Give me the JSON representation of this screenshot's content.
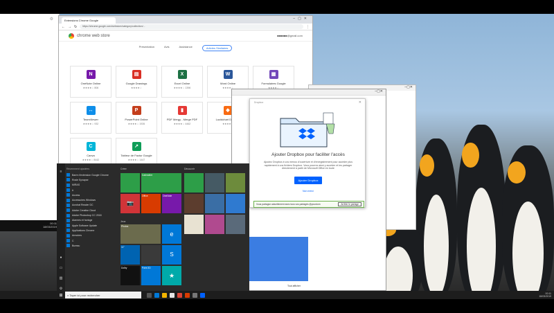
{
  "chrome": {
    "tab_title": "Extensions Chrome Google",
    "url": "https://chrome.google.com/webstore/category/collection/...",
    "store_title": "chrome web store",
    "user_email": "■■■■■■@gmail.com",
    "categories": [
      "Présentation",
      "Avis",
      "Assistance",
      "Articles Similaires"
    ],
    "apps": [
      {
        "name": "OneNote Online",
        "color": "#7719aa",
        "glyph": "N",
        "rating": "★★★★☆ 806"
      },
      {
        "name": "Google Drawings",
        "color": "#d93025",
        "glyph": "▤",
        "rating": "★★★★☆"
      },
      {
        "name": "Excel Online",
        "color": "#1e7145",
        "glyph": "X",
        "rating": "★★★★☆ 1396"
      },
      {
        "name": "Word Online",
        "color": "#2b579a",
        "glyph": "W",
        "rating": "★★★★☆"
      },
      {
        "name": "Formulaires Google",
        "color": "#7248b9",
        "glyph": "▦",
        "rating": "★★★★☆"
      },
      {
        "name": "TeamViewer",
        "color": "#0e8ee9",
        "glyph": "↔",
        "rating": "★★★★☆ 932"
      },
      {
        "name": "PowerPoint Online",
        "color": "#c43e1c",
        "glyph": "P",
        "rating": "★★★★☆ 1926"
      },
      {
        "name": "PDF Mergy - Merge PDF",
        "color": "#e53935",
        "glyph": "▮",
        "rating": "★★★★☆ 4462"
      },
      {
        "name": "Lucidchart Diagram",
        "color": "#f96b13",
        "glyph": "◆",
        "rating": "★★★★☆"
      },
      {
        "name": "",
        "color": "#ffffff",
        "glyph": "",
        "rating": ""
      },
      {
        "name": "Canva",
        "color": "#00b5d8",
        "glyph": "C",
        "rating": "★★★★☆ 8442"
      },
      {
        "name": "Tableur de Factur Google",
        "color": "#0f9d58",
        "glyph": "↗",
        "rating": "★★★★☆ 1447"
      }
    ]
  },
  "dropbox": {
    "window_title": "Dropbox",
    "heading": "Ajouter Dropbox pour faciliter l'accès",
    "description": "Ajoutez Dropbox à vos menus d'ouverture et d'enregistrement pour accéder plus rapidement à vos fichiers Dropbox. Vous pourrez ainsi y accéder et les partager directement à partir de Microsoft Office en toute",
    "cta": "Ajouter Dropbox",
    "decline": "Non merci",
    "share_text": "Vous partagez actuellement avec tous vos partagés @yourdom",
    "share_button": "Arrêter le partage"
  },
  "midwin": {
    "voir": "Tout afficher"
  },
  "startmenu": {
    "recent_header": "Récemment ajoutées",
    "items": [
      "Barre d'extension Google Chrome",
      "Rosie Synapse",
      "MIRAS",
      "#",
      "Access",
      "Accessoires Windows",
      "Acrobat Reader DC",
      "Adobe Creative Cloud",
      "Adobe Photoshop CC 2018",
      "Alarmes et horloge",
      "Apple Software Update",
      "Applications Chrome",
      "Armoires",
      "C",
      "Bureau"
    ],
    "groups": {
      "create": "Créer",
      "play": "Jeux",
      "explore": "Découvrir"
    },
    "tiles": {
      "calendar": "Calendrier",
      "mail": "Courrier",
      "photos": "Photos",
      "office": "Office",
      "onenote": "OneNote",
      "edge": "Microsoft Edge",
      "weather": "11°",
      "skype": "Skype",
      "xbox": "Xbox",
      "dolby": "Dolby",
      "paint": "Paint 3D"
    }
  },
  "taskbar": {
    "search_placeholder": "Taper ici pour rechercher",
    "time": "00:11",
    "date": "18/03/2019"
  },
  "leftwin": {
    "time": "00:11",
    "date": "18/03/2019"
  }
}
